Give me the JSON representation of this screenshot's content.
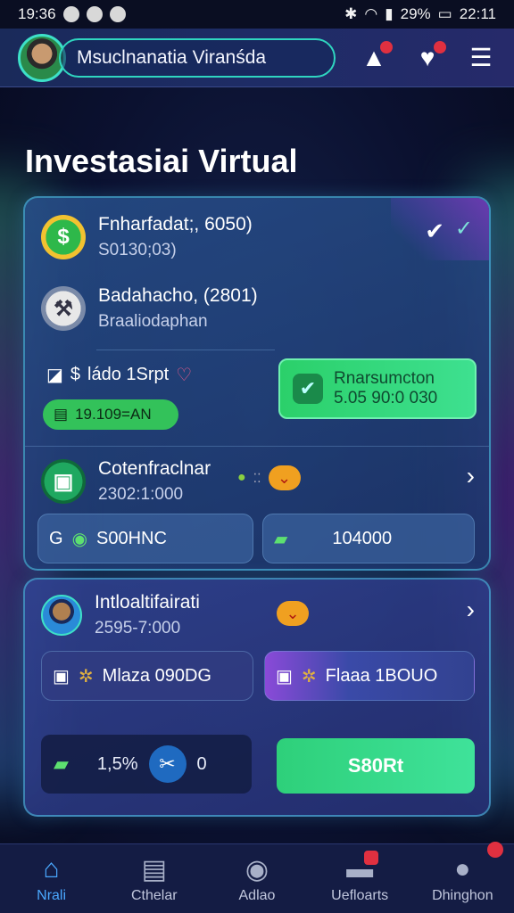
{
  "status": {
    "time": "19:36",
    "battery": "29%",
    "clock_right": "22:11"
  },
  "header": {
    "user_name": "Msuclnanatia Viranśda"
  },
  "page": {
    "title": "Investasiai Virtual"
  },
  "card1": {
    "item1": {
      "title": "Fnharfadat;, 6050)",
      "subtitle": "S0130;03)"
    },
    "item2": {
      "title": "Badahacho, (2801)",
      "subtitle": "Braaliodaphan"
    },
    "profit_label": "ládo 1Srpt",
    "green_pill": "19.109=AN",
    "green_card": {
      "line1": "Rnarsumcton",
      "line2": "5.05 90:0 030"
    },
    "item3": {
      "title": "Cotenfraclnar",
      "subtitle": "2302:1:000"
    },
    "btn_left": "S00HNC",
    "btn_right": "104000"
  },
  "card2": {
    "title": "Intloaltifairati",
    "subtitle": "2595-7:000",
    "btn_left": "Mlaza 090DG",
    "btn_right": "Flaaa 1BOUO",
    "panel_value": "1,5%",
    "panel_suffix": "0",
    "action_label": "S80Rt"
  },
  "nav": [
    {
      "label": "Nrali",
      "icon": "home-icon"
    },
    {
      "label": "Cthelar",
      "icon": "document-icon"
    },
    {
      "label": "Adlao",
      "icon": "compass-icon"
    },
    {
      "label": "Uefloarts",
      "icon": "mail-icon"
    },
    {
      "label": "Dhinghon",
      "icon": "user-icon"
    }
  ]
}
